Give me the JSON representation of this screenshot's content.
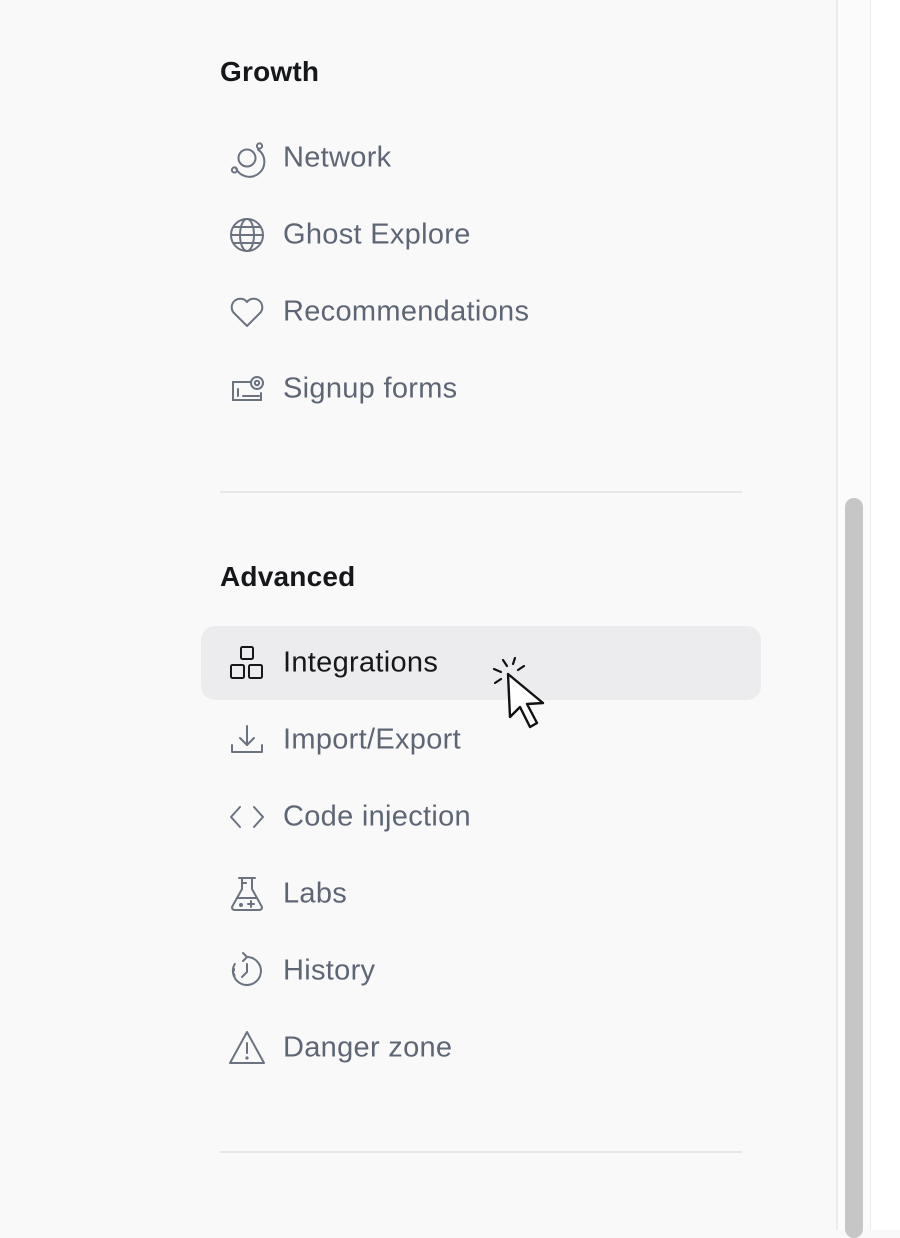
{
  "sections": [
    {
      "title": "Growth",
      "items": [
        {
          "label": "Network",
          "icon": "network-icon"
        },
        {
          "label": "Ghost Explore",
          "icon": "globe-icon"
        },
        {
          "label": "Recommendations",
          "icon": "heart-icon"
        },
        {
          "label": "Signup forms",
          "icon": "signup-form-icon"
        }
      ]
    },
    {
      "title": "Advanced",
      "items": [
        {
          "label": "Integrations",
          "icon": "integrations-icon",
          "active": true
        },
        {
          "label": "Import/Export",
          "icon": "download-icon"
        },
        {
          "label": "Code injection",
          "icon": "code-icon"
        },
        {
          "label": "Labs",
          "icon": "flask-icon"
        },
        {
          "label": "History",
          "icon": "history-icon"
        },
        {
          "label": "Danger zone",
          "icon": "warning-icon"
        }
      ]
    }
  ],
  "colors": {
    "background": "#f9f9fa",
    "active_item_bg": "#ececee",
    "heading_text": "#15171a",
    "item_text": "#5e6675",
    "icon_stroke": "#6b7280",
    "divider": "#e5e7eb",
    "scrollbar_thumb": "#c6c6c6"
  }
}
